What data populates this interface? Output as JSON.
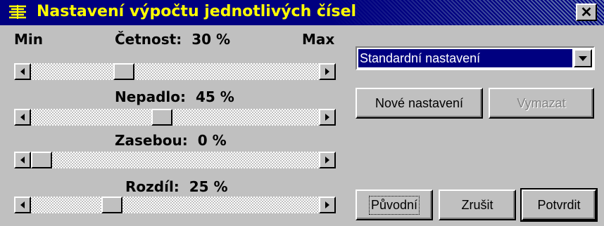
{
  "window": {
    "title": "Nastavení výpočtu jednotlivých čísel",
    "icon": "app-icon",
    "close_label": "✕"
  },
  "sliders": {
    "min_label": "Min",
    "max_label": "Max",
    "items": [
      {
        "name": "cetnost",
        "label": "Četnost:",
        "value_text": "30 %",
        "value": 30
      },
      {
        "name": "nepadlo",
        "label": "Nepadlo:",
        "value_text": "45 %",
        "value": 45
      },
      {
        "name": "zasebou",
        "label": "Zasebou:",
        "value_text": "0 %",
        "value": 0
      },
      {
        "name": "rozdil",
        "label": "Rozdíl:",
        "value_text": "25 %",
        "value": 25
      }
    ]
  },
  "preset": {
    "selected": "Standardní nastavení"
  },
  "buttons": {
    "new": "Nové nastavení",
    "delete": "Vymazat",
    "original": "Původní",
    "cancel": "Zrušit",
    "confirm": "Potvrdit"
  },
  "colors": {
    "title_bg": "#000080",
    "title_text": "#ffff00",
    "face": "#c0c0c0",
    "selection": "#000080"
  }
}
